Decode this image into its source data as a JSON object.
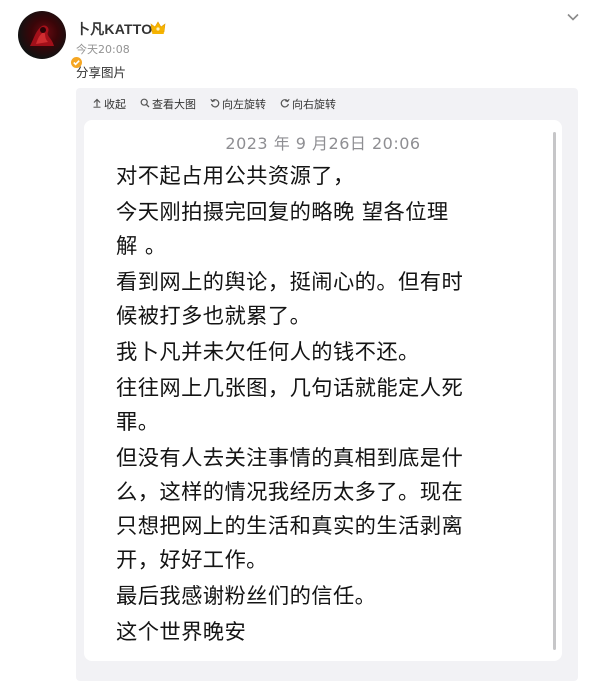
{
  "post": {
    "username": "卜凡KATTO",
    "timestamp": "今天20:08",
    "text": "分享图片"
  },
  "toolbar": {
    "collapse": "收起",
    "view_large": "查看大图",
    "rotate_left": "向左旋转",
    "rotate_right": "向右旋转"
  },
  "note": {
    "date": "2023 年 9 月26日 20:06",
    "lines": [
      "对不起占用公共资源了，",
      "今天刚拍摄完回复的略晚 望各位理",
      "解 。",
      "看到网上的舆论，挺闹心的。但有时",
      "候被打多也就累了。",
      "我卜凡并未欠任何人的钱不还。",
      "往往网上几张图，几句话就能定人死",
      "罪。",
      "但没有人去关注事情的真相到底是什",
      "么，这样的情况我经历太多了。现在",
      "只想把网上的生活和真实的生活剥离",
      "开，好好工作。",
      "最后我感谢粉丝们的信任。",
      "这个世界晚安"
    ]
  },
  "icons": {
    "avatar": "avatar-art",
    "verified": "verified-badge-icon",
    "vip": "vip-crown-icon",
    "collapse_post": "chevron-down-icon"
  },
  "colors": {
    "verified": "#f5a623",
    "vip": "#f6b400",
    "muted_text": "#939393",
    "media_bg": "#f2f2f5"
  }
}
